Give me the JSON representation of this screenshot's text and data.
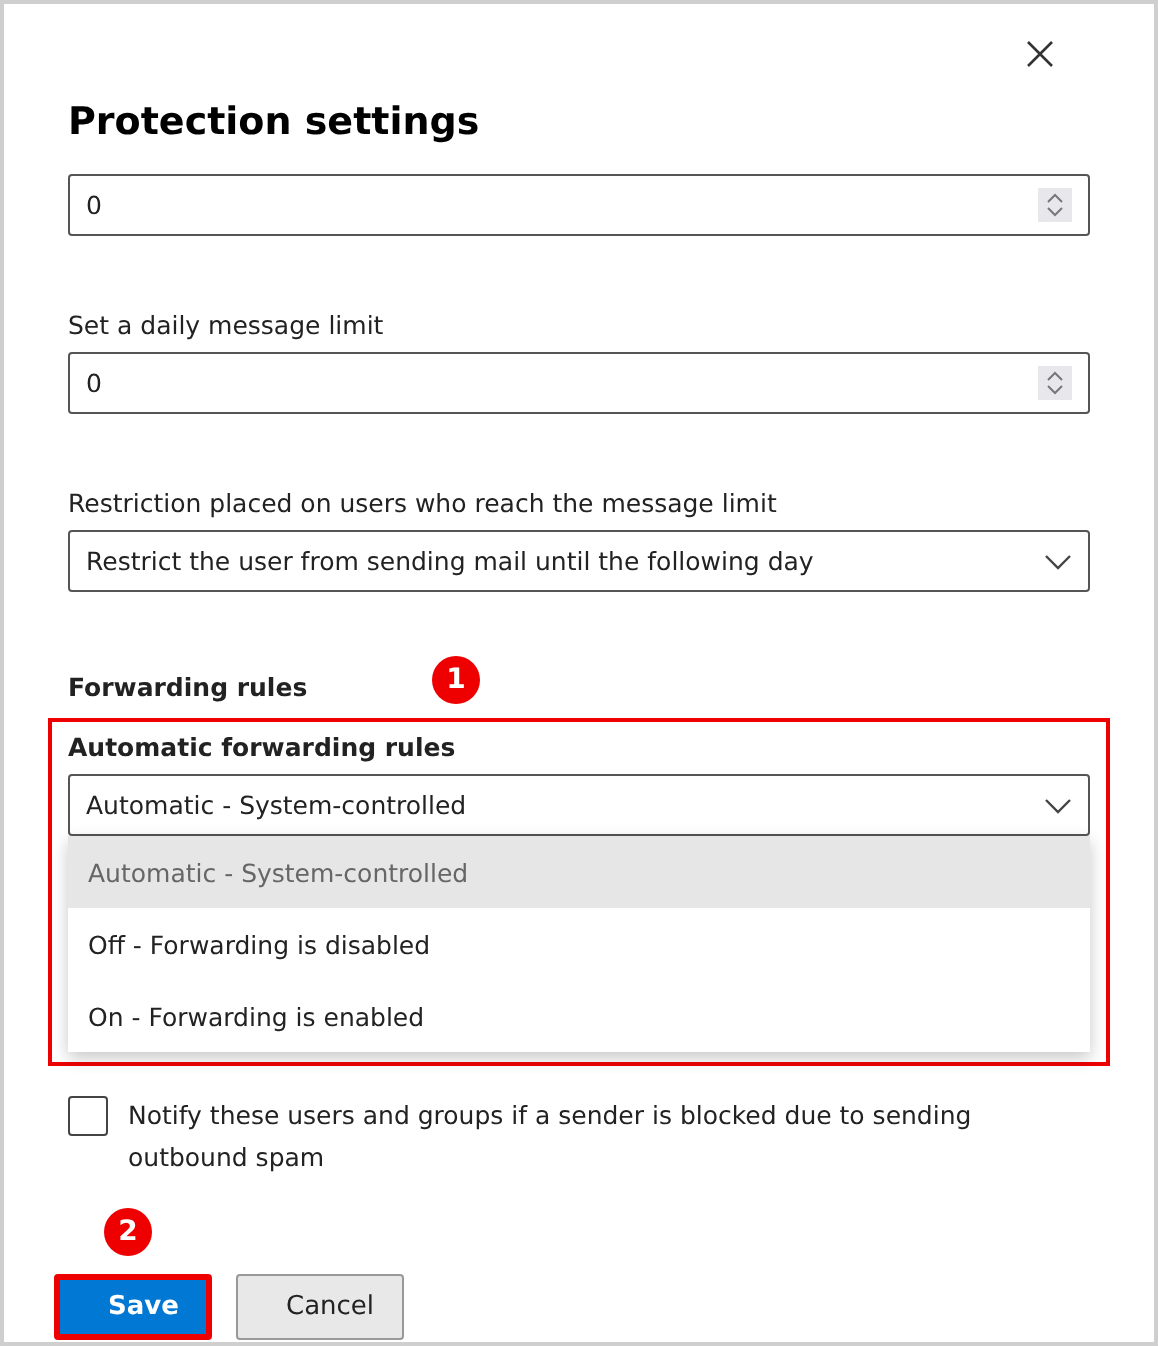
{
  "title": "Protection settings",
  "fields": [
    {
      "kind": "number",
      "value": "0"
    },
    {
      "kind": "number",
      "label": "Set a daily message limit",
      "value": "0"
    },
    {
      "kind": "select",
      "label": "Restriction placed on users who reach the message limit",
      "value": "Restrict the user from sending mail until the following day"
    }
  ],
  "forwarding": {
    "heading": "Forwarding rules",
    "callout": "1",
    "label": "Automatic forwarding rules",
    "value": "Automatic - System-controlled",
    "expanded": true,
    "options": [
      {
        "label": "Automatic - System-controlled",
        "selected": true
      },
      {
        "label": "Off - Forwarding is disabled",
        "selected": false
      },
      {
        "label": "On - Forwarding is enabled",
        "selected": false
      }
    ]
  },
  "notify": {
    "label": "Notify these users and groups if a sender is blocked due to sending outbound spam",
    "checked": false
  },
  "buttons": [
    {
      "label": "Save",
      "kind": "primary",
      "callout": "2"
    },
    {
      "label": "Cancel",
      "kind": "secondary"
    }
  ]
}
